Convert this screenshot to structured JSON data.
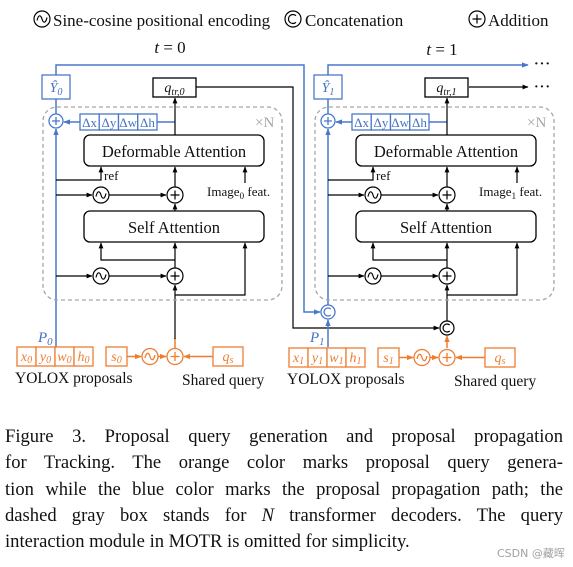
{
  "legend": {
    "items": [
      {
        "icon": "sine-wave-icon",
        "label": "Sine-cosine positional encoding"
      },
      {
        "icon": "concatenation-icon",
        "label": "Concatenation"
      },
      {
        "icon": "addition-icon",
        "label": "Addition"
      }
    ]
  },
  "panels": [
    {
      "time_label": {
        "var": "t",
        "rest": " = 0"
      },
      "y_hat": {
        "base": "Ŷ",
        "sub": "0"
      },
      "query": {
        "base": "q",
        "sub": "tr,0"
      },
      "deltas": [
        "Δx",
        "Δy",
        "Δw",
        "Δh"
      ],
      "repeat_label": "×N",
      "deformable_attention": "Deformable Attention",
      "ref_label": "ref",
      "image_feat": {
        "base": "Image",
        "sub": "0",
        "suffix": " feat."
      },
      "self_attention": "Self Attention",
      "proposal_label": {
        "base": "P",
        "sub": "0"
      },
      "proposal_cells": [
        {
          "base": "x",
          "sub": "0"
        },
        {
          "base": "y",
          "sub": "0"
        },
        {
          "base": "w",
          "sub": "0"
        },
        {
          "base": "h",
          "sub": "0"
        }
      ],
      "score": {
        "base": "s",
        "sub": "0"
      },
      "shared_query": {
        "base": "q",
        "sub": "s"
      },
      "proposals_caption": "YOLOX proposals",
      "shared_query_caption": "Shared query"
    },
    {
      "time_label": {
        "var": "t",
        "rest": " = 1"
      },
      "y_hat": {
        "base": "Ŷ",
        "sub": "1"
      },
      "query": {
        "base": "q",
        "sub": "tr,1"
      },
      "deltas": [
        "Δx",
        "Δy",
        "Δw",
        "Δh"
      ],
      "repeat_label": "×N",
      "deformable_attention": "Deformable Attention",
      "ref_label": "ref",
      "image_feat": {
        "base": "Image",
        "sub": "1",
        "suffix": " feat."
      },
      "self_attention": "Self Attention",
      "proposal_label": {
        "base": "P",
        "sub": "1"
      },
      "proposal_cells": [
        {
          "base": "x",
          "sub": "1"
        },
        {
          "base": "y",
          "sub": "1"
        },
        {
          "base": "w",
          "sub": "1"
        },
        {
          "base": "h",
          "sub": "1"
        }
      ],
      "score": {
        "base": "s",
        "sub": "1"
      },
      "shared_query": {
        "base": "q",
        "sub": "s"
      },
      "proposals_caption": "YOLOX proposals",
      "shared_query_caption": "Shared query"
    }
  ],
  "continuation": "···",
  "caption": {
    "lines": [
      {
        "text": "Figure 3.  Proposal query generation and proposal propagation"
      },
      {
        "text": "for Tracking.  The orange color marks proposal query genera-"
      },
      {
        "text": "tion while the blue color marks the proposal propagation path; the"
      },
      {
        "before": "dashed gray box stands for ",
        "var": "N",
        "after": " transformer decoders.  The query"
      },
      {
        "text": "interaction module in MOTR is omitted for simplicity."
      }
    ]
  },
  "watermark": "CSDN @藏晖",
  "colors": {
    "propagation_path": "#4472C4",
    "proposal_query_generation": "#ED7D31",
    "decoder_box_dashed": "#A6A6A6"
  }
}
